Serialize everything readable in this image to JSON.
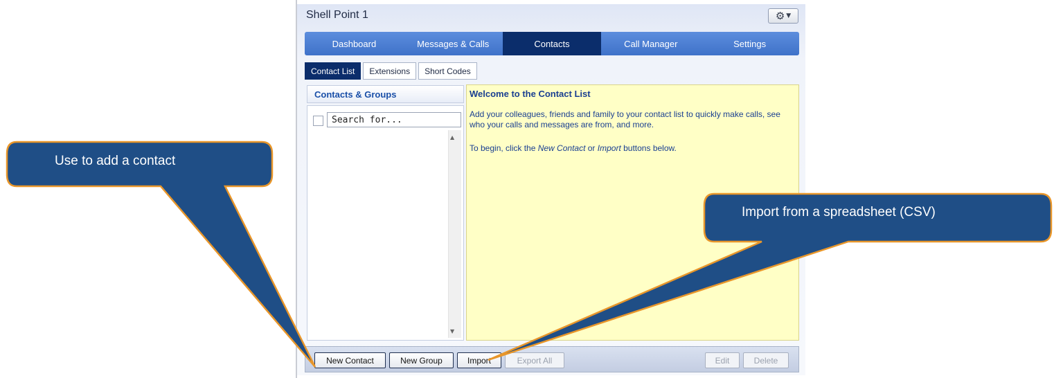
{
  "app": {
    "title": "Shell Point 1",
    "gear_icon": "gear-icon",
    "nav_tabs": [
      {
        "label": "Dashboard"
      },
      {
        "label": "Messages & Calls"
      },
      {
        "label": "Contacts"
      },
      {
        "label": "Call Manager"
      },
      {
        "label": "Settings"
      }
    ],
    "active_nav_tab": "Contacts",
    "sub_tabs": [
      {
        "label": "Contact List"
      },
      {
        "label": "Extensions"
      },
      {
        "label": "Short Codes"
      }
    ],
    "active_sub_tab": "Contact List"
  },
  "contacts_panel": {
    "header": "Contacts & Groups",
    "search_placeholder": "Search for..."
  },
  "welcome": {
    "title": "Welcome to the Contact List",
    "body": "Add your colleagues, friends and family to your contact list to quickly make calls, see who your calls and messages are from, and more.",
    "line2_prefix": "To begin, click the ",
    "line2_new_contact": "New Contact",
    "line2_or": " or ",
    "line2_import": "Import",
    "line2_suffix": " buttons below."
  },
  "toolbar": {
    "new_contact": "New Contact",
    "new_group": "New Group",
    "import": "Import",
    "export_all": "Export All",
    "edit": "Edit",
    "delete": "Delete"
  },
  "callouts": {
    "add_contact": "Use to add a contact",
    "import_csv": "Import from a spreadsheet (CSV)"
  },
  "colors": {
    "callout_fill": "#1f4e86",
    "callout_border": "#e8962a",
    "nav_active": "#0b2d6b",
    "nav_bg": "#4a7fd6",
    "welcome_bg": "#ffffc6"
  }
}
